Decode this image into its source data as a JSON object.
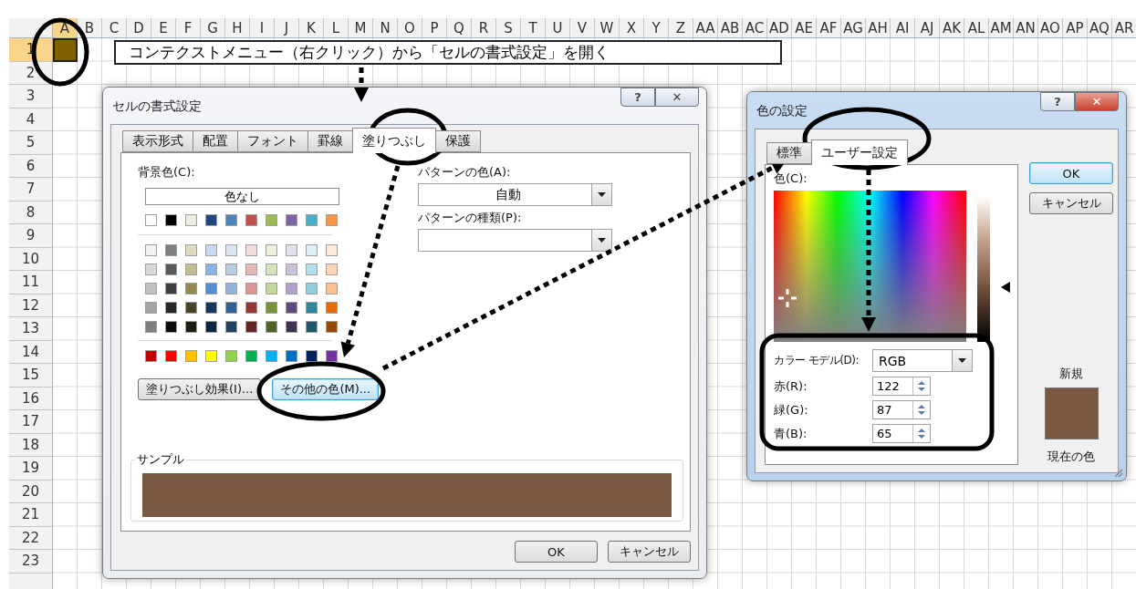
{
  "sheet": {
    "columns": [
      {
        "label": "A",
        "selected": true
      },
      {
        "label": "B",
        "selected": false
      },
      {
        "label": "C",
        "selected": false
      },
      {
        "label": "D",
        "selected": false
      },
      {
        "label": "E",
        "selected": false
      },
      {
        "label": "F",
        "selected": false
      },
      {
        "label": "G",
        "selected": false
      },
      {
        "label": "H",
        "selected": false
      },
      {
        "label": "I",
        "selected": false
      },
      {
        "label": "J",
        "selected": false
      },
      {
        "label": "K",
        "selected": false
      },
      {
        "label": "L",
        "selected": false
      },
      {
        "label": "M",
        "selected": false
      },
      {
        "label": "N",
        "selected": false
      },
      {
        "label": "O",
        "selected": false
      },
      {
        "label": "P",
        "selected": false
      },
      {
        "label": "Q",
        "selected": false
      },
      {
        "label": "R",
        "selected": false
      },
      {
        "label": "S",
        "selected": false
      },
      {
        "label": "T",
        "selected": false
      },
      {
        "label": "U",
        "selected": false
      },
      {
        "label": "V",
        "selected": false
      },
      {
        "label": "W",
        "selected": false
      },
      {
        "label": "X",
        "selected": false
      },
      {
        "label": "Y",
        "selected": false
      },
      {
        "label": "Z",
        "selected": false
      },
      {
        "label": "AA",
        "selected": false
      },
      {
        "label": "AB",
        "selected": false
      },
      {
        "label": "AC",
        "selected": false
      },
      {
        "label": "AD",
        "selected": false
      },
      {
        "label": "AE",
        "selected": false
      },
      {
        "label": "AF",
        "selected": false
      },
      {
        "label": "AG",
        "selected": false
      },
      {
        "label": "AH",
        "selected": false
      },
      {
        "label": "AI",
        "selected": false
      },
      {
        "label": "AJ",
        "selected": false
      },
      {
        "label": "AK",
        "selected": false
      },
      {
        "label": "AL",
        "selected": false
      },
      {
        "label": "AM",
        "selected": false
      },
      {
        "label": "AN",
        "selected": false
      },
      {
        "label": "AO",
        "selected": false
      },
      {
        "label": "AP",
        "selected": false
      },
      {
        "label": "AQ",
        "selected": false
      },
      {
        "label": "AR",
        "selected": false
      }
    ],
    "rows": [
      {
        "label": "1",
        "selected": true
      },
      {
        "label": "2",
        "selected": false
      },
      {
        "label": "3",
        "selected": false
      },
      {
        "label": "4",
        "selected": false
      },
      {
        "label": "5",
        "selected": false
      },
      {
        "label": "6",
        "selected": false
      },
      {
        "label": "7",
        "selected": false
      },
      {
        "label": "8",
        "selected": false
      },
      {
        "label": "9",
        "selected": false
      },
      {
        "label": "10",
        "selected": false
      },
      {
        "label": "11",
        "selected": false
      },
      {
        "label": "12",
        "selected": false
      },
      {
        "label": "13",
        "selected": false
      },
      {
        "label": "14",
        "selected": false
      },
      {
        "label": "15",
        "selected": false
      },
      {
        "label": "16",
        "selected": false
      },
      {
        "label": "17",
        "selected": false
      },
      {
        "label": "18",
        "selected": false
      },
      {
        "label": "19",
        "selected": false
      },
      {
        "label": "20",
        "selected": false
      },
      {
        "label": "21",
        "selected": false
      },
      {
        "label": "22",
        "selected": false
      },
      {
        "label": "23",
        "selected": false
      }
    ],
    "active_cell": {
      "color": "#7f6000"
    }
  },
  "callout": {
    "text": "コンテクストメニュー（右クリック）から「セルの書式設定」を開く"
  },
  "format_dialog": {
    "title": "セルの書式設定",
    "help_button": "?",
    "close_button": "✕",
    "tabs": [
      {
        "label": "表示形式",
        "selected": false
      },
      {
        "label": "配置",
        "selected": false
      },
      {
        "label": "フォント",
        "selected": false
      },
      {
        "label": "罫線",
        "selected": false
      },
      {
        "label": "塗りつぶし",
        "selected": true
      },
      {
        "label": "保護",
        "selected": false
      }
    ],
    "background_label": "背景色(C):",
    "no_color_button": "色なし",
    "theme_colors": [
      {
        "color": "#ffffff"
      },
      {
        "color": "#000000"
      },
      {
        "color": "#eeece1"
      },
      {
        "color": "#1f497d"
      },
      {
        "color": "#4f81bd"
      },
      {
        "color": "#c0504d"
      },
      {
        "color": "#9bbb59"
      },
      {
        "color": "#8064a2"
      },
      {
        "color": "#4bacc6"
      },
      {
        "color": "#f79646"
      }
    ],
    "tint_rows": [
      [
        {
          "color": "#f2f2f2"
        },
        {
          "color": "#7f7f7f"
        },
        {
          "color": "#ddd9c3"
        },
        {
          "color": "#c6d9f0"
        },
        {
          "color": "#dbe5f1"
        },
        {
          "color": "#f2dcdb"
        },
        {
          "color": "#ebf1dd"
        },
        {
          "color": "#e5e0ec"
        },
        {
          "color": "#dbeef3"
        },
        {
          "color": "#fdeada"
        }
      ],
      [
        {
          "color": "#d8d8d8"
        },
        {
          "color": "#595959"
        },
        {
          "color": "#c4bd97"
        },
        {
          "color": "#8db3e2"
        },
        {
          "color": "#b8cce4"
        },
        {
          "color": "#e5b9b7"
        },
        {
          "color": "#d7e3bc"
        },
        {
          "color": "#ccc1d9"
        },
        {
          "color": "#b7dde8"
        },
        {
          "color": "#fbd5b5"
        }
      ],
      [
        {
          "color": "#bfbfbf"
        },
        {
          "color": "#3f3f3f"
        },
        {
          "color": "#938953"
        },
        {
          "color": "#548dd4"
        },
        {
          "color": "#95b3d7"
        },
        {
          "color": "#d99694"
        },
        {
          "color": "#c3d69b"
        },
        {
          "color": "#b2a2c7"
        },
        {
          "color": "#92cddc"
        },
        {
          "color": "#fac08f"
        }
      ],
      [
        {
          "color": "#a5a5a5"
        },
        {
          "color": "#262626"
        },
        {
          "color": "#494429"
        },
        {
          "color": "#17365d"
        },
        {
          "color": "#366092"
        },
        {
          "color": "#953734"
        },
        {
          "color": "#76923c"
        },
        {
          "color": "#5f497a"
        },
        {
          "color": "#31859b"
        },
        {
          "color": "#e36c09"
        }
      ],
      [
        {
          "color": "#7f7f7f"
        },
        {
          "color": "#0c0c0c"
        },
        {
          "color": "#1d1b10"
        },
        {
          "color": "#0f243e"
        },
        {
          "color": "#244061"
        },
        {
          "color": "#632423"
        },
        {
          "color": "#4f6128"
        },
        {
          "color": "#3f3151"
        },
        {
          "color": "#205867"
        },
        {
          "color": "#974806"
        }
      ]
    ],
    "standard_colors": [
      {
        "color": "#c00000"
      },
      {
        "color": "#ff0000"
      },
      {
        "color": "#ffc000"
      },
      {
        "color": "#ffff00"
      },
      {
        "color": "#92d050"
      },
      {
        "color": "#00b050"
      },
      {
        "color": "#00b0f0"
      },
      {
        "color": "#0070c0"
      },
      {
        "color": "#002060"
      },
      {
        "color": "#7030a0"
      }
    ],
    "fill_effects_button": "塗りつぶし効果(I)...",
    "more_colors_button": "その他の色(M)...",
    "pattern_color_label": "パターンの色(A):",
    "pattern_color_value": "自動",
    "pattern_style_label": "パターンの種類(P):",
    "sample": {
      "label": "サンプル",
      "color": "#7a5841"
    },
    "buttons": [
      {
        "label": "OK"
      },
      {
        "label": "キャンセル"
      }
    ]
  },
  "color_dialog": {
    "title": "色の設定",
    "help_button": "?",
    "close_button": "✕",
    "tabs": [
      {
        "label": "標準",
        "selected": false
      },
      {
        "label": "ユーザー設定",
        "selected": true
      }
    ],
    "color_label": "色(C):",
    "model_label": "カラー モデル(D):",
    "model_value": "RGB",
    "channels": [
      {
        "label": "赤(R):",
        "value": "122"
      },
      {
        "label": "緑(G):",
        "value": "87"
      },
      {
        "label": "青(B):",
        "value": "65"
      }
    ],
    "buttons": [
      {
        "label": "OK",
        "focused": true
      },
      {
        "label": "キャンセル",
        "focused": false
      }
    ],
    "new_label": "新規",
    "preview": {
      "color": "#7a5841"
    },
    "current_label": "現在の色"
  }
}
